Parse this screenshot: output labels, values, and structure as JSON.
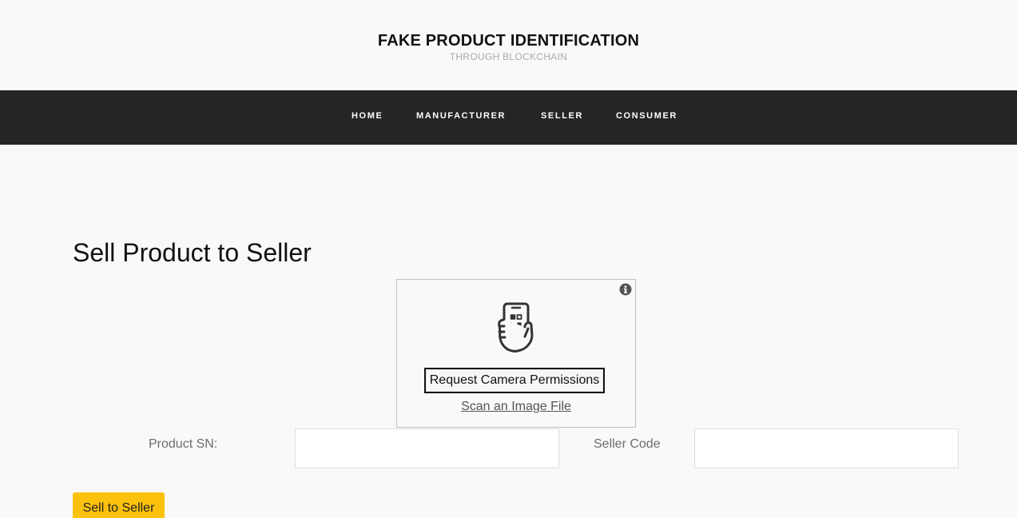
{
  "header": {
    "title": "FAKE PRODUCT IDENTIFICATION",
    "subtitle": "THROUGH BLOCKCHAIN"
  },
  "nav": {
    "items": [
      {
        "label": "HOME"
      },
      {
        "label": "MANUFACTURER"
      },
      {
        "label": "SELLER"
      },
      {
        "label": "CONSUMER"
      }
    ]
  },
  "main": {
    "heading": "Sell Product to Seller",
    "scanner": {
      "info_icon": "info-icon",
      "phone_icon": "phone-qr-scan-icon",
      "camera_button_label": "Request Camera Permissions",
      "scan_file_link": "Scan an Image File"
    },
    "form": {
      "product_sn_label": "Product SN:",
      "product_sn_value": "",
      "seller_code_label": "Seller Code",
      "seller_code_value": "",
      "submit_label": "Sell to Seller"
    }
  },
  "colors": {
    "navbar_bg": "#252525",
    "accent_button": "#fcc10c",
    "page_bg": "#f9f9f9"
  }
}
